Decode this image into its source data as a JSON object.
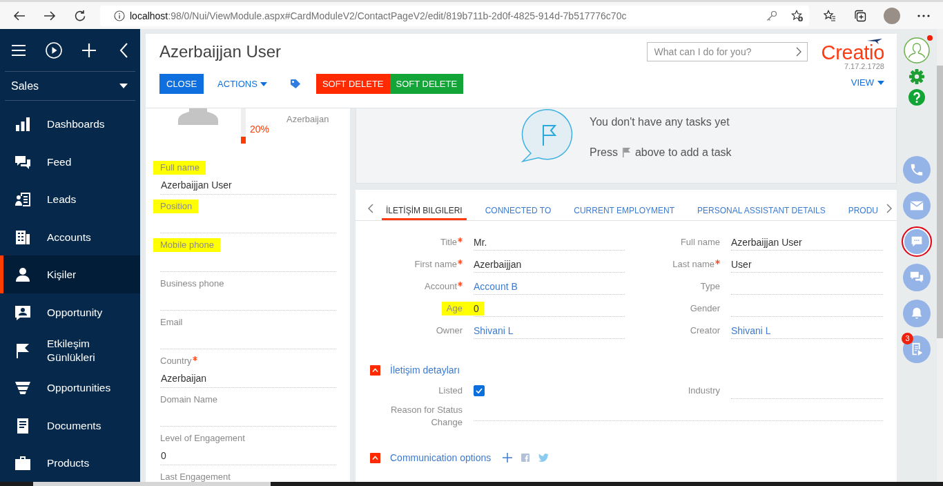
{
  "browser": {
    "url_host": "localhost",
    "url_path": ":98/0/Nui/ViewModule.aspx#CardModuleV2/ContactPageV2/edit/819b711b-2d0f-4825-914d-7b517776c70c"
  },
  "sidebar": {
    "workplace": "Sales",
    "items": [
      {
        "label": "Dashboards",
        "selected": false
      },
      {
        "label": "Feed",
        "selected": false
      },
      {
        "label": "Leads",
        "selected": false
      },
      {
        "label": "Accounts",
        "selected": false
      },
      {
        "label": "Kişiler",
        "selected": true
      },
      {
        "label": "Opportunity",
        "selected": false
      },
      {
        "label": "Etkileşim Günlükleri",
        "selected": false
      },
      {
        "label": "Opportunities",
        "selected": false
      },
      {
        "label": "Documents",
        "selected": false
      },
      {
        "label": "Products",
        "selected": false
      }
    ]
  },
  "header": {
    "title": "Azerbaijjan User",
    "buttons": [
      {
        "kind": "primary",
        "label": "CLOSE"
      },
      {
        "kind": "dropdown",
        "label": "ACTIONS"
      },
      {
        "kind": "icon"
      },
      {
        "kind": "colored",
        "label": "SOFT DELETE",
        "color": "#ff2a00"
      },
      {
        "kind": "colored",
        "label": "SOFT DELETE",
        "color": "#13a538"
      }
    ],
    "search": {
      "placeholder": "What can I do for you?"
    },
    "logo": "Creatio",
    "version": "7.17.2.1728",
    "view_menu": "VIEW"
  },
  "profile": {
    "completeness": "20%",
    "level": 0.2,
    "location": "Azerbaijan",
    "fields": [
      {
        "label": "Full name",
        "value": "Azerbaijjan User",
        "required": false,
        "highlighted": true
      },
      {
        "label": "Position",
        "required": false,
        "highlighted": true
      },
      {
        "label": "Mobile phone",
        "required": false,
        "highlighted": true
      },
      {
        "label": "Business phone",
        "required": false,
        "highlighted": false
      },
      {
        "label": "Email",
        "required": false,
        "highlighted": false
      },
      {
        "label": "Country",
        "value": "Azerbaijan",
        "required": true,
        "highlighted": false
      },
      {
        "label": "Domain Name",
        "required": false,
        "highlighted": false
      },
      {
        "label": "Level of Engagement",
        "value": "0",
        "required": false,
        "highlighted": false
      },
      {
        "label": "Last Engagement",
        "required": false,
        "highlighted": false
      }
    ]
  },
  "tasks": {
    "message": "You don't have any tasks yet",
    "hint_before": "Press",
    "hint_after": "above to add a task"
  },
  "tabs": [
    {
      "label": "İLETİŞİM BILGILERI",
      "selected": true
    },
    {
      "label": "CONNECTED TO",
      "selected": false
    },
    {
      "label": "CURRENT EMPLOYMENT",
      "selected": false
    },
    {
      "label": "PERSONAL ASSISTANT DETAILS",
      "selected": false
    },
    {
      "label": "PRODU",
      "selected": false
    }
  ],
  "details": {
    "left": [
      {
        "label": "Title",
        "required": true,
        "highlighted": false,
        "kind": "text",
        "value": "Mr."
      },
      {
        "label": "First name",
        "required": true,
        "highlighted": false,
        "kind": "text",
        "value": "Azerbaijjan"
      },
      {
        "label": "Account",
        "required": true,
        "highlighted": false,
        "kind": "link",
        "value": "Account B"
      },
      {
        "label": "Age",
        "required": false,
        "highlighted": true,
        "kind": "text",
        "value": "0"
      },
      {
        "label": "Owner",
        "required": false,
        "highlighted": false,
        "kind": "link",
        "value": "Shivani L"
      }
    ],
    "right": [
      {
        "label": "Full name",
        "required": false,
        "highlighted": false,
        "kind": "text",
        "value": "Azerbaijjan User"
      },
      {
        "label": "Last name",
        "required": true,
        "highlighted": false,
        "kind": "text",
        "value": "User"
      },
      {
        "label": "Type",
        "required": false,
        "highlighted": false,
        "kind": "text"
      },
      {
        "label": "Gender",
        "required": false,
        "highlighted": false,
        "kind": "text"
      },
      {
        "label": "Creator",
        "required": false,
        "highlighted": false,
        "kind": "link",
        "value": "Shivani L"
      }
    ]
  },
  "sections": [
    {
      "kind": "fields",
      "title": "İletişim detayları",
      "expanded": true,
      "fields": [
        {
          "kind": "checkbox",
          "label": "Listed",
          "checked": true
        },
        {
          "kind": "text",
          "label": "Industry"
        },
        {
          "kind": "wide",
          "label": "Reason for Status Change"
        }
      ]
    },
    {
      "kind": "communication",
      "title": "Communication options",
      "expanded": true
    }
  ],
  "right_panel": {
    "profile_alert": true,
    "actions": [
      {
        "selected": false
      },
      {
        "selected": false
      },
      {
        "selected": true
      },
      {
        "selected": false
      },
      {
        "selected": false
      },
      {
        "selected": false,
        "badge": "3"
      }
    ]
  }
}
